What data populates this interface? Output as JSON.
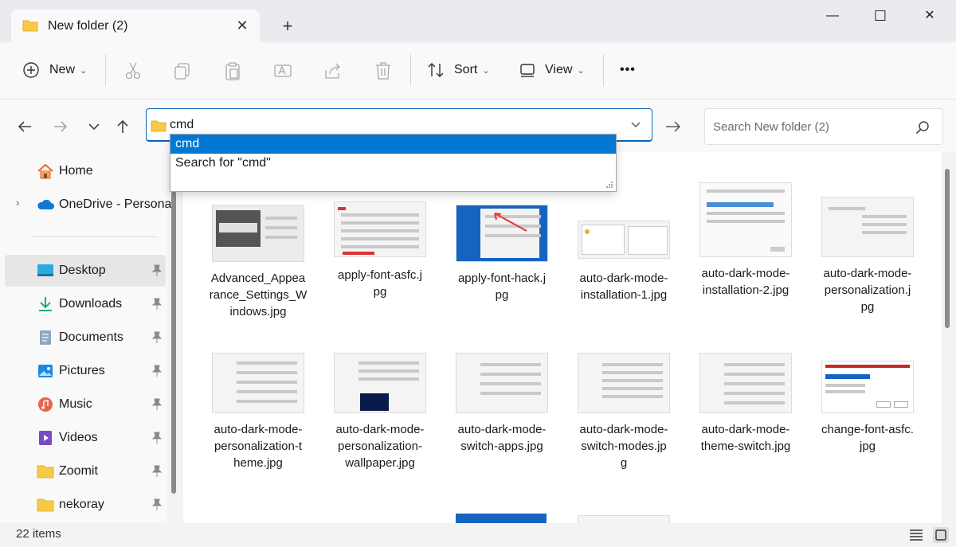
{
  "window": {
    "tab_title": "New folder (2)",
    "new_tab": "+",
    "controls": {
      "minimize": "—",
      "maximize": "☐",
      "close": "✕"
    }
  },
  "toolbar": {
    "new_label": "New",
    "sort_label": "Sort",
    "view_label": "View",
    "more_label": "•••"
  },
  "navigation": {
    "address_value": "cmd",
    "search_placeholder": "Search New folder (2)"
  },
  "suggestions": [
    "cmd",
    "Search for \"cmd\""
  ],
  "sidebar": {
    "items": [
      {
        "label": "Home",
        "icon": "home-icon",
        "pinned": false
      },
      {
        "label": "OneDrive - Personal",
        "icon": "cloud-icon",
        "pinned": false
      },
      {
        "label": "Desktop",
        "icon": "desktop-icon",
        "pinned": true,
        "selected": true
      },
      {
        "label": "Downloads",
        "icon": "download-icon",
        "pinned": true
      },
      {
        "label": "Documents",
        "icon": "document-icon",
        "pinned": true
      },
      {
        "label": "Pictures",
        "icon": "pictures-icon",
        "pinned": true
      },
      {
        "label": "Music",
        "icon": "music-icon",
        "pinned": true
      },
      {
        "label": "Videos",
        "icon": "videos-icon",
        "pinned": true
      },
      {
        "label": "Zoomit",
        "icon": "folder-icon",
        "pinned": true
      },
      {
        "label": "nekoray",
        "icon": "folder-icon",
        "pinned": true
      }
    ]
  },
  "files": [
    {
      "name": "Advanced_Appearance_Settings_Windows.jpg",
      "lines": [
        "Advanced_Appea",
        "rance_Settings_W",
        "indows.jpg"
      ]
    },
    {
      "name": "apply-font-asfc.jpg",
      "lines": [
        "apply-font-asfc.j",
        "pg"
      ]
    },
    {
      "name": "apply-font-hack.jpg",
      "lines": [
        "apply-font-hack.j",
        "pg"
      ]
    },
    {
      "name": "auto-dark-mode-installation-1.jpg",
      "lines": [
        "auto-dark-mode-",
        "installation-1.jpg"
      ]
    },
    {
      "name": "auto-dark-mode-installation-2.jpg",
      "lines": [
        "auto-dark-mode-",
        "installation-2.jpg"
      ]
    },
    {
      "name": "auto-dark-mode-personalization.jpg",
      "lines": [
        "auto-dark-mode-",
        "personalization.j",
        "pg"
      ]
    },
    {
      "name": "auto-dark-mode-personalization-theme.jpg",
      "lines": [
        "auto-dark-mode-",
        "personalization-t",
        "heme.jpg"
      ]
    },
    {
      "name": "auto-dark-mode-personalization-wallpaper.jpg",
      "lines": [
        "auto-dark-mode-",
        "personalization-",
        "wallpaper.jpg"
      ]
    },
    {
      "name": "auto-dark-mode-switch-apps.jpg",
      "lines": [
        "auto-dark-mode-",
        "switch-apps.jpg"
      ]
    },
    {
      "name": "auto-dark-mode-switch-modes.jpg",
      "lines": [
        "auto-dark-mode-",
        "switch-modes.jp",
        "g"
      ]
    },
    {
      "name": "auto-dark-mode-theme-switch.jpg",
      "lines": [
        "auto-dark-mode-",
        "theme-switch.jpg"
      ]
    },
    {
      "name": "change-font-asfc.jpg",
      "lines": [
        "change-font-asfc.",
        "jpg"
      ]
    }
  ],
  "status": {
    "item_count": "22 items"
  },
  "colors": {
    "accent": "#0078d4",
    "folder": "#f7c948"
  }
}
